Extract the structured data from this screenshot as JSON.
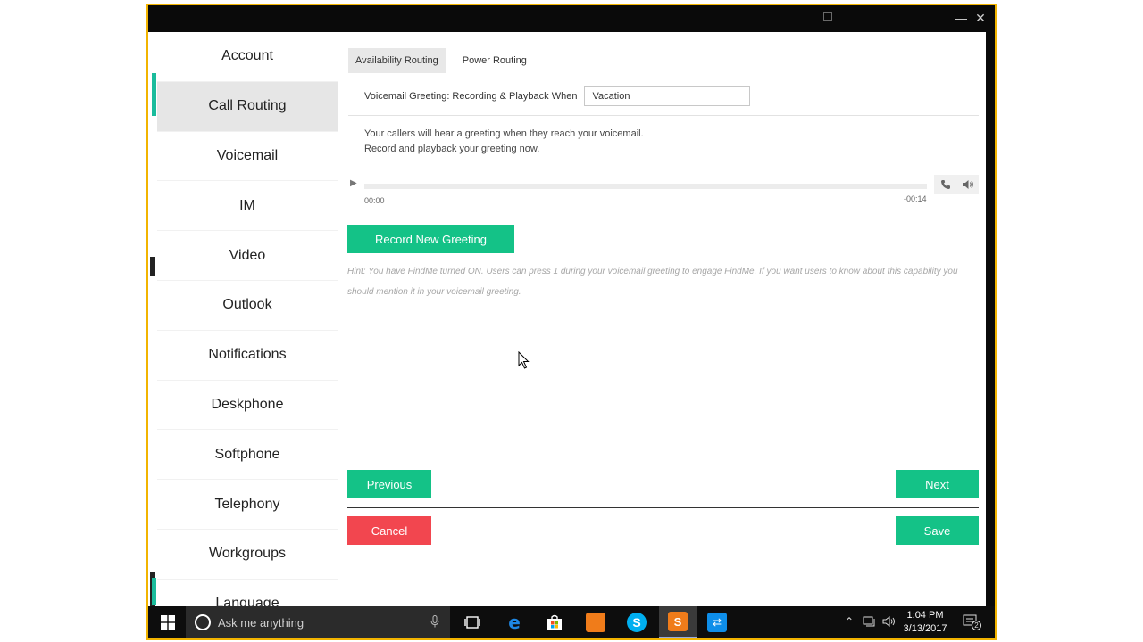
{
  "window": {
    "minimize_glyph": "—",
    "close_glyph": "✕"
  },
  "sidebar": {
    "items": [
      {
        "label": "Account"
      },
      {
        "label": "Call Routing",
        "active": true
      },
      {
        "label": "Voicemail"
      },
      {
        "label": "IM"
      },
      {
        "label": "Video"
      },
      {
        "label": "Outlook"
      },
      {
        "label": "Notifications"
      },
      {
        "label": "Deskphone"
      },
      {
        "label": "Softphone"
      },
      {
        "label": "Telephony"
      },
      {
        "label": "Workgroups"
      },
      {
        "label": "Language"
      }
    ]
  },
  "main": {
    "tabs": [
      {
        "label": "Availability Routing",
        "active": true
      },
      {
        "label": "Power Routing"
      }
    ],
    "voicemail_label": "Voicemail Greeting: Recording & Playback When",
    "voicemail_select": "Vacation",
    "description_line1": "Your callers will hear a greeting when they reach your voicemail.",
    "description_line2": "Record and playback your greeting now.",
    "player": {
      "time_start": "00:00",
      "time_end": "-00:14",
      "progress": 0,
      "icons": [
        "play-icon",
        "phone-icon",
        "speaker-icon"
      ]
    },
    "record_button": "Record New Greeting",
    "hint": "Hint: You have FindMe turned ON. Users can press 1 during your voicemail greeting to engage FindMe. If you want users to know about this capability you should mention it in your voicemail greeting.",
    "previous_button": "Previous",
    "next_button": "Next",
    "cancel_button": "Cancel",
    "save_button": "Save"
  },
  "taskbar": {
    "search_placeholder": "Ask me anything",
    "clock_time": "1:04 PM",
    "clock_date": "3/13/2017",
    "notification_count": "2"
  },
  "colors": {
    "accent_green": "#14c287",
    "cancel_red": "#f2464f",
    "window_border": "#f2b400"
  }
}
